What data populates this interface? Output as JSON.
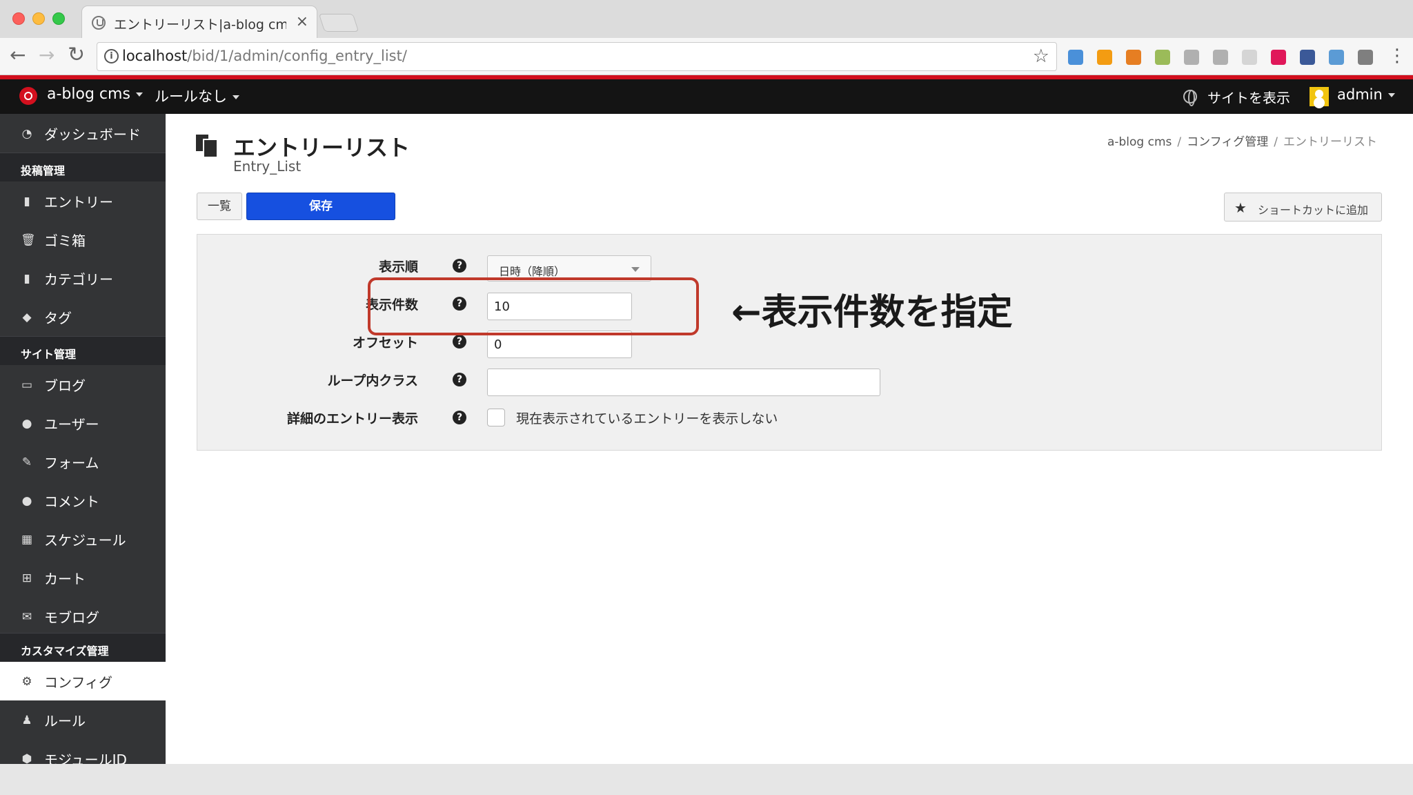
{
  "browser": {
    "tab_title": "エントリーリスト|a-blog cms|管理",
    "tab_close": "×",
    "nav": {
      "back": "←",
      "forward": "→",
      "reload": "↻"
    },
    "url_host": "localhost",
    "url_path": "/bid/1/admin/config_entry_list/",
    "info_glyph": "i",
    "star_glyph": "☆",
    "menu_glyph": "⋮",
    "extensions": [
      {
        "icon": "translate-ext-icon",
        "color": "#4a90d9"
      },
      {
        "icon": "chart-ext-icon",
        "color": "#f39c12"
      },
      {
        "icon": "color-wheel-ext-icon",
        "color": "#e67e22"
      },
      {
        "icon": "document-ext-icon",
        "color": "#9bbb59"
      },
      {
        "icon": "skype-ext-icon",
        "color": "#b0b0b0"
      },
      {
        "icon": "compass-ext-icon",
        "color": "#b0b0b0"
      },
      {
        "icon": "blank-ext-icon",
        "color": "#d5d5d5"
      },
      {
        "icon": "record-ext-icon",
        "color": "#e0185a"
      },
      {
        "icon": "facebook-ext-icon",
        "color": "#3b5998"
      },
      {
        "icon": "window-ext-icon",
        "color": "#5b9bd5"
      },
      {
        "icon": "puzzle-ext-icon",
        "color": "#7f7f7f"
      }
    ]
  },
  "topbar": {
    "brand": "a-blog cms",
    "rule_menu": "ルールなし",
    "view_site": "サイトを表示",
    "user": "admin"
  },
  "sidebar": {
    "dashboard": "ダッシュボード",
    "sections": [
      {
        "title": "投稿管理",
        "items": [
          "エントリー",
          "ゴミ箱",
          "カテゴリー",
          "タグ"
        ]
      },
      {
        "title": "サイト管理",
        "items": [
          "ブログ",
          "ユーザー",
          "フォーム",
          "コメント",
          "スケジュール",
          "カート",
          "モブログ"
        ]
      },
      {
        "title": "カスタマイズ管理",
        "items": [
          "コンフィグ",
          "ルール",
          "モジュールID"
        ]
      }
    ],
    "active_item": "コンフィグ"
  },
  "page": {
    "title": "エントリーリスト",
    "subtitle": "Entry_List",
    "breadcrumbs": [
      "a-blog cms",
      "コンフィグ管理",
      "エントリーリスト"
    ],
    "breadcrumb_sep": "/",
    "buttons": {
      "list": "一覧",
      "save": "保存",
      "shortcut": "ショートカットに追加",
      "shortcut_star": "★"
    }
  },
  "form": {
    "order": {
      "label": "表示順",
      "value": "日時（降順）"
    },
    "limit": {
      "label": "表示件数",
      "value": "10"
    },
    "offset": {
      "label": "オフセット",
      "value": "0"
    },
    "loop_class": {
      "label": "ループ内クラス",
      "value": ""
    },
    "detail": {
      "label": "詳細のエントリー表示",
      "checkbox_label": "現在表示されているエントリーを表示しない",
      "checked": false
    },
    "help_glyph": "?"
  },
  "annotation": {
    "text": "←表示件数を指定",
    "color": "#c0392b"
  }
}
